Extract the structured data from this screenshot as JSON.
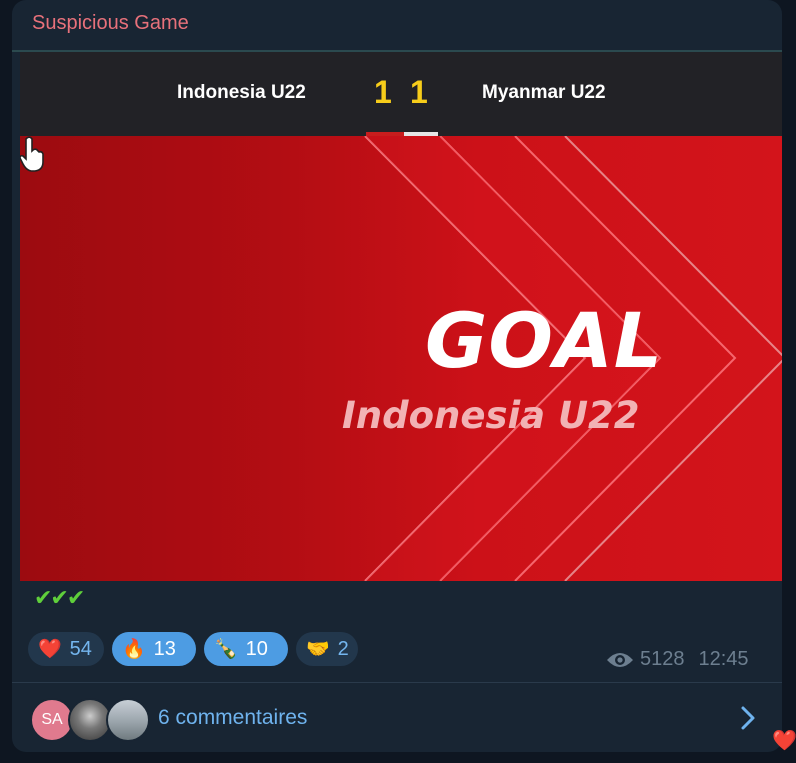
{
  "post": {
    "channel_title": "Suspicious Game",
    "scoreboard": {
      "home_team": "Indonesia U22",
      "home_score": "1",
      "away_score": "1",
      "away_team": "Myanmar U22"
    },
    "banner": {
      "headline": "GOAL",
      "team": "Indonesia U22"
    },
    "message_text": "✔✔✔",
    "reactions": [
      {
        "emoji": "❤️",
        "count": "54",
        "active": false
      },
      {
        "emoji": "🔥",
        "count": "13",
        "active": true
      },
      {
        "emoji": "🍾",
        "count": "10",
        "active": true
      },
      {
        "emoji": "🤝",
        "count": "2",
        "active": false
      }
    ],
    "views": "5128",
    "time": "12:45",
    "comments": {
      "avatars": [
        {
          "initials": "SA",
          "color": "#e07a8e"
        },
        {
          "initials": ""
        },
        {
          "initials": ""
        }
      ],
      "label": "6 commentaires"
    },
    "corner_heart": "❤️"
  },
  "colors": {
    "channel_title": "#e8717b",
    "score": "#f7cd1a",
    "link": "#6fb3ee",
    "reaction_active_bg": "#4d9ce3",
    "banner_red": "#c8101a"
  }
}
